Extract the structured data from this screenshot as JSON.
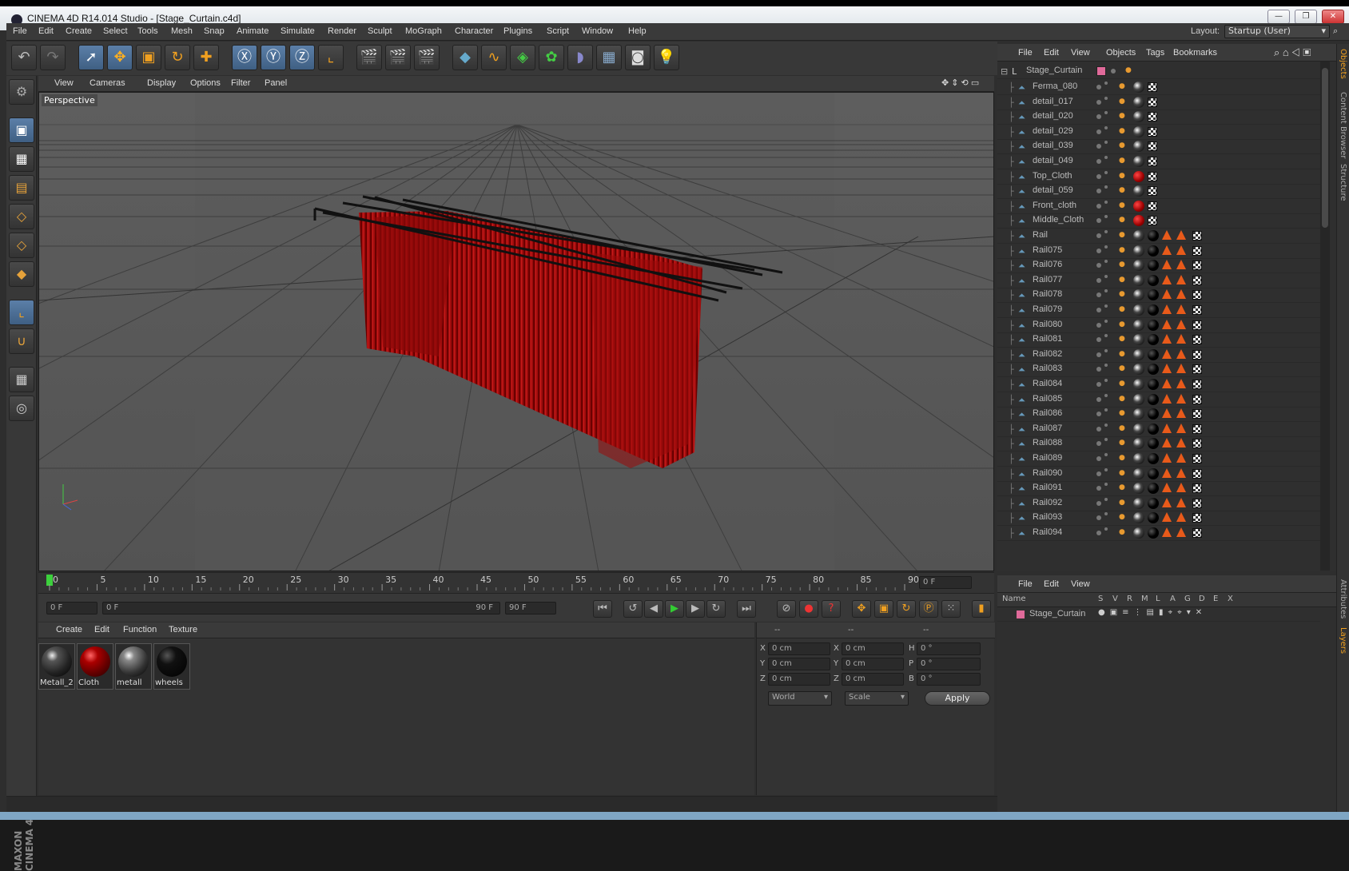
{
  "window": {
    "title": "CINEMA 4D R14.014 Studio - [Stage_Curtain.c4d]",
    "minimize": "—",
    "restore": "❐",
    "close": "✕"
  },
  "menubar": {
    "items": [
      "File",
      "Edit",
      "Create",
      "Select",
      "Tools",
      "Mesh",
      "Snap",
      "Animate",
      "Simulate",
      "Render",
      "Sculpt",
      "MoGraph",
      "Character",
      "Plugins",
      "Script",
      "Window",
      "Help"
    ],
    "layout_label": "Layout:",
    "layout_value": "Startup (User)"
  },
  "toolbar": {
    "icons": [
      "undo-icon",
      "redo-icon",
      "live-selection-icon",
      "move-icon",
      "scale-icon",
      "rotate-icon",
      "recent-tool-icon",
      "x-axis-icon",
      "y-axis-icon",
      "z-axis-icon",
      "coordinate-system-icon",
      "render-view-icon",
      "render-picture-viewer-icon",
      "render-settings-icon",
      "cube-object-icon",
      "spline-icon",
      "nurbs-icon",
      "array-icon",
      "deformer-icon",
      "environment-icon",
      "camera-icon",
      "light-icon"
    ]
  },
  "viewport": {
    "menu": [
      "View",
      "Cameras",
      "Display",
      "Options",
      "Filter",
      "Panel"
    ],
    "label": "Perspective"
  },
  "timeline": {
    "ticks": [
      "0",
      "5",
      "10",
      "15",
      "20",
      "25",
      "30",
      "35",
      "40",
      "45",
      "50",
      "55",
      "60",
      "65",
      "70",
      "75",
      "80",
      "85",
      "90"
    ],
    "current_frame": "0 F",
    "start_field": "0 F",
    "range_start": "0 F",
    "range_end": "90 F",
    "end_field": "90 F"
  },
  "materials": {
    "menu": [
      "Create",
      "Edit",
      "Function",
      "Texture"
    ],
    "items": [
      {
        "label": "Metall_2",
        "color": "#2a2a2a"
      },
      {
        "label": "Cloth",
        "color": "#8a0d0d"
      },
      {
        "label": "metall",
        "color": "#3a3a3a"
      },
      {
        "label": "wheels",
        "color": "#050505"
      }
    ]
  },
  "coordinates": {
    "headers": [
      "--",
      "--",
      "--"
    ],
    "rows": [
      {
        "a": "X",
        "av": "0 cm",
        "b": "X",
        "bv": "0 cm",
        "c": "H",
        "cv": "0 °"
      },
      {
        "a": "Y",
        "av": "0 cm",
        "b": "Y",
        "bv": "0 cm",
        "c": "P",
        "cv": "0 °"
      },
      {
        "a": "Z",
        "av": "0 cm",
        "b": "Z",
        "bv": "0 cm",
        "c": "B",
        "cv": "0 °"
      }
    ],
    "mode1": "World",
    "mode2": "Scale",
    "apply": "Apply"
  },
  "object_manager": {
    "menu": [
      "File",
      "Edit",
      "View",
      "Objects",
      "Tags",
      "Bookmarks"
    ],
    "root": "Stage_Curtain",
    "objects": [
      {
        "name": "Ferma_080",
        "mat": "black",
        "rail": false
      },
      {
        "name": "detail_017",
        "mat": "black",
        "rail": false
      },
      {
        "name": "detail_020",
        "mat": "black",
        "rail": false
      },
      {
        "name": "detail_029",
        "mat": "black",
        "rail": false
      },
      {
        "name": "detail_039",
        "mat": "black",
        "rail": false
      },
      {
        "name": "detail_049",
        "mat": "black",
        "rail": false
      },
      {
        "name": "Top_Cloth",
        "mat": "red",
        "rail": false
      },
      {
        "name": "detail_059",
        "mat": "black",
        "rail": false
      },
      {
        "name": "Front_cloth",
        "mat": "red",
        "rail": false
      },
      {
        "name": "Middle_Cloth",
        "mat": "red",
        "rail": false
      },
      {
        "name": "Rail",
        "mat": "black",
        "rail": true
      },
      {
        "name": "Rail075",
        "mat": "black",
        "rail": true
      },
      {
        "name": "Rail076",
        "mat": "black",
        "rail": true
      },
      {
        "name": "Rail077",
        "mat": "black",
        "rail": true
      },
      {
        "name": "Rail078",
        "mat": "black",
        "rail": true
      },
      {
        "name": "Rail079",
        "mat": "black",
        "rail": true
      },
      {
        "name": "Rail080",
        "mat": "black",
        "rail": true
      },
      {
        "name": "Rail081",
        "mat": "black",
        "rail": true
      },
      {
        "name": "Rail082",
        "mat": "black",
        "rail": true
      },
      {
        "name": "Rail083",
        "mat": "black",
        "rail": true
      },
      {
        "name": "Rail084",
        "mat": "black",
        "rail": true
      },
      {
        "name": "Rail085",
        "mat": "black",
        "rail": true
      },
      {
        "name": "Rail086",
        "mat": "black",
        "rail": true
      },
      {
        "name": "Rail087",
        "mat": "black",
        "rail": true
      },
      {
        "name": "Rail088",
        "mat": "black",
        "rail": true
      },
      {
        "name": "Rail089",
        "mat": "black",
        "rail": true
      },
      {
        "name": "Rail090",
        "mat": "black",
        "rail": true
      },
      {
        "name": "Rail091",
        "mat": "black",
        "rail": true
      },
      {
        "name": "Rail092",
        "mat": "black",
        "rail": true
      },
      {
        "name": "Rail093",
        "mat": "black",
        "rail": true
      },
      {
        "name": "Rail094",
        "mat": "black",
        "rail": true
      }
    ]
  },
  "layers": {
    "menu": [
      "File",
      "Edit",
      "View"
    ],
    "columns": [
      "Name",
      "S",
      "V",
      "R",
      "M",
      "L",
      "A",
      "G",
      "D",
      "E",
      "X"
    ],
    "rows": [
      {
        "name": "Stage_Curtain",
        "color": "#e06a9a"
      }
    ]
  },
  "right_tabs": [
    "Objects",
    "Content Browser",
    "Structure",
    "Attributes",
    "Layers"
  ],
  "branding": {
    "logo": "MAXON CINEMA 4D"
  },
  "colors": {
    "accent": "#5b7fa8",
    "cloth": "#9a0c0c",
    "rail_tag": "#e85a1a"
  }
}
